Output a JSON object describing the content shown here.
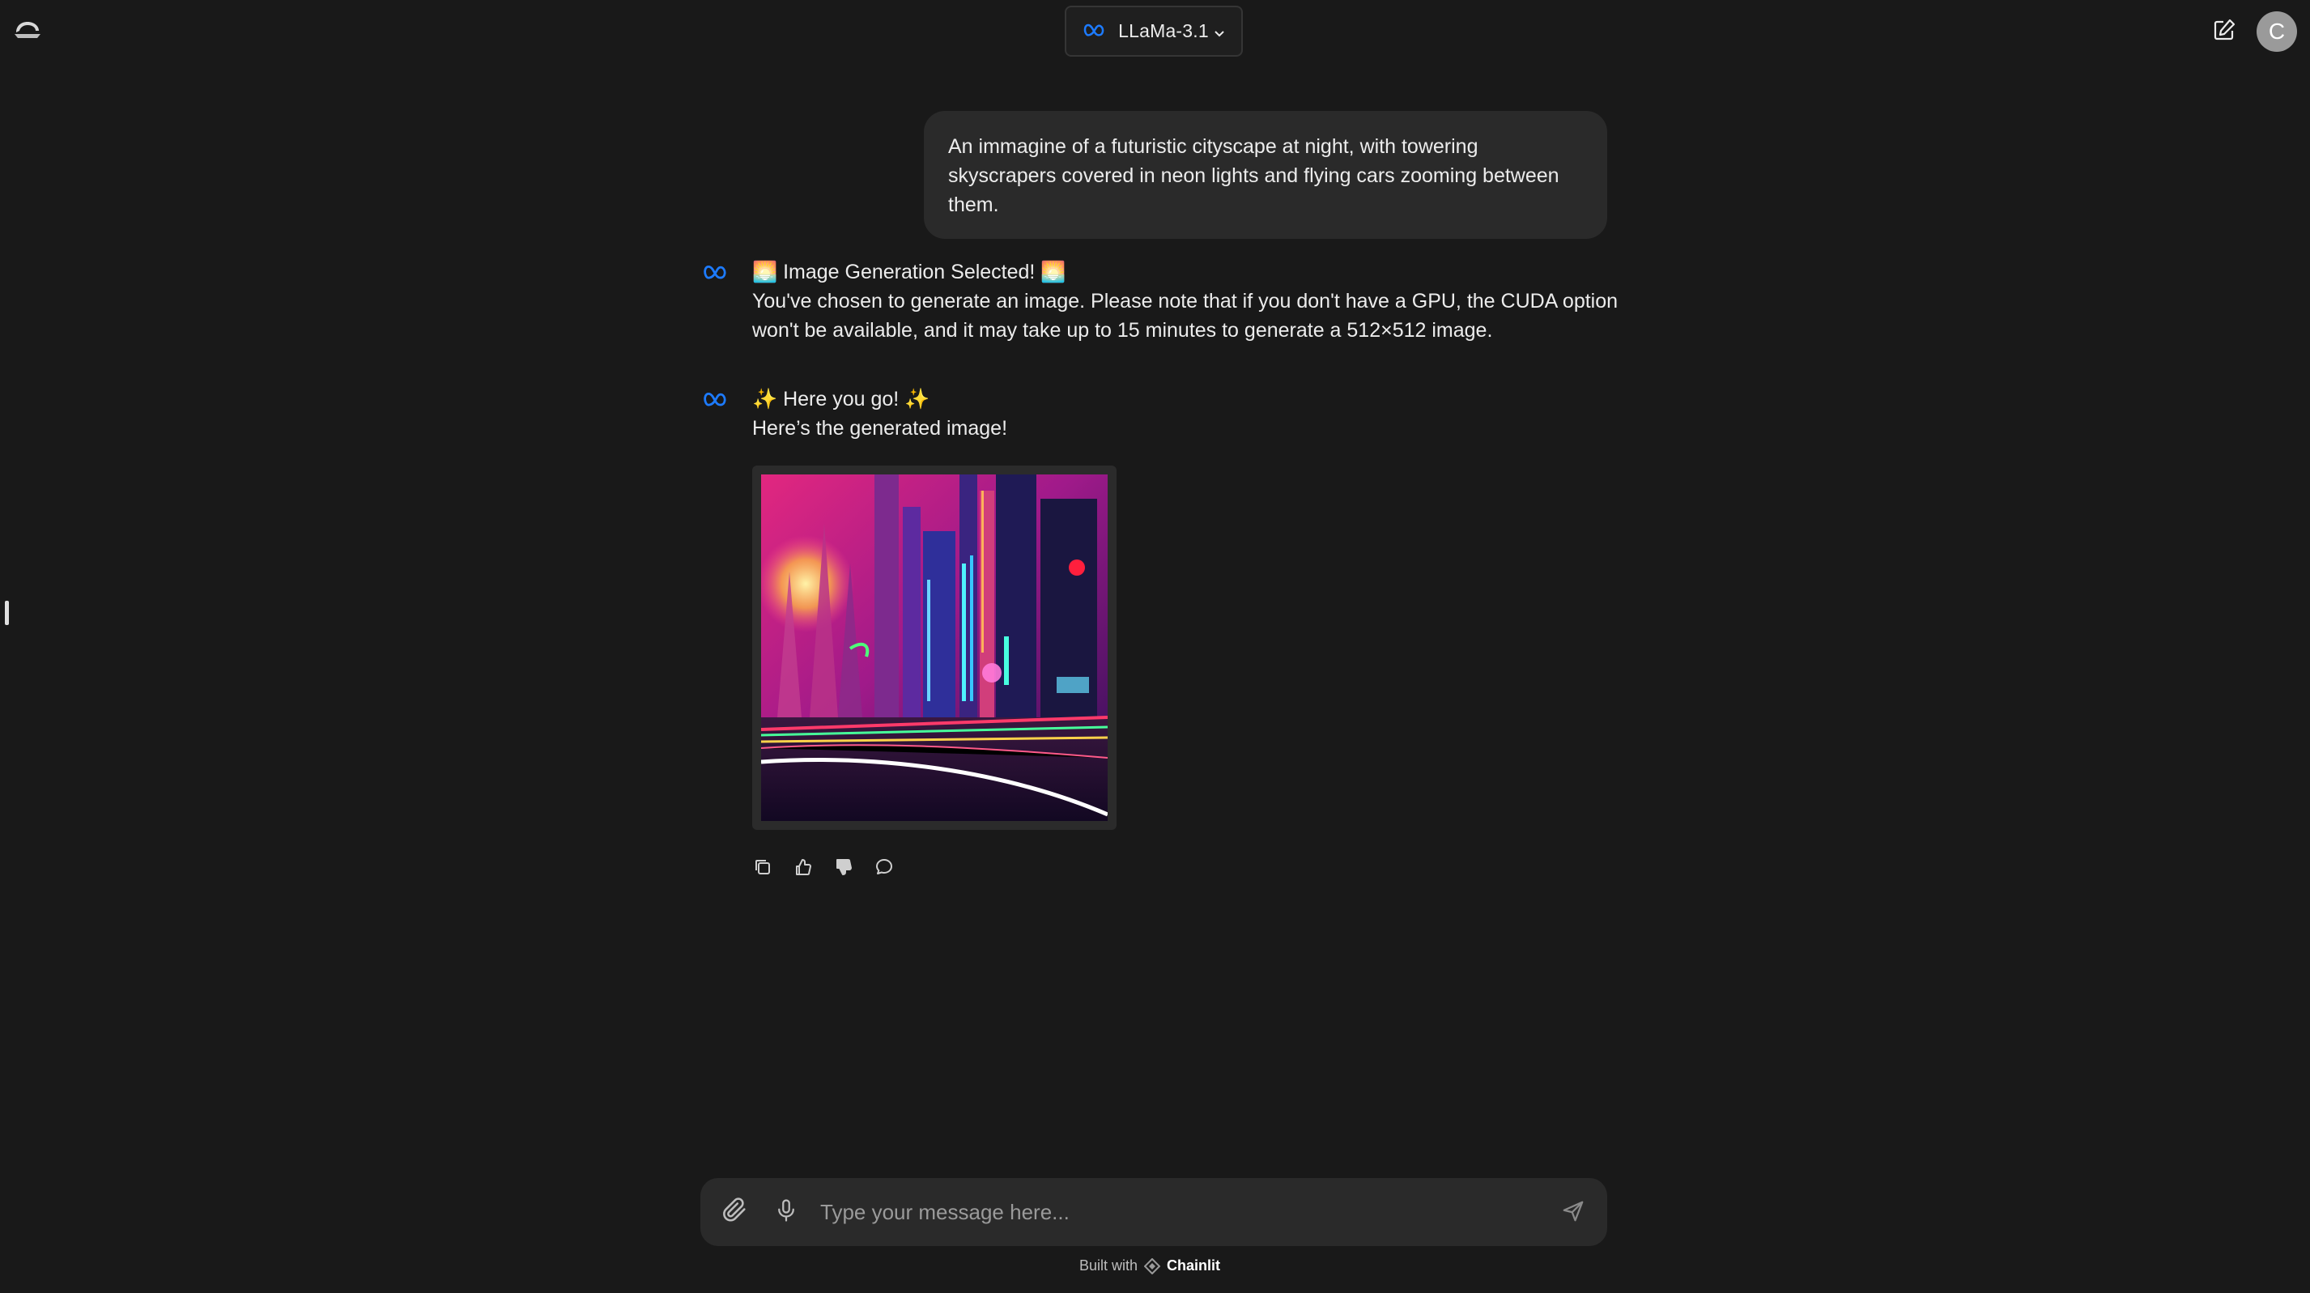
{
  "header": {
    "logo_icon": "chainlit-logo-icon",
    "model": {
      "label": "LLaMa-3.1",
      "icon": "meta-infinity-icon",
      "dropdown_icon": "chevron-down-icon"
    },
    "new_chat_icon": "edit-icon",
    "avatar_letter": "C"
  },
  "messages": {
    "user": {
      "text": "An immagine of a futuristic cityscape at night, with towering skyscrapers covered in neon lights and flying cars zooming between them."
    },
    "assistant_1": {
      "title": "🌅 Image Generation Selected! 🌅",
      "body": "You've chosen to generate an image. Please note that if you don't have a GPU, the CUDA option won't be available, and it may take up to 15 minutes to generate a 512×512 image."
    },
    "assistant_2": {
      "title": "✨ Here you go! ✨",
      "body": "Here’s the generated image!"
    }
  },
  "actions": {
    "icons": [
      "copy-icon",
      "thumbs-up-icon",
      "thumbs-down-icon",
      "comment-icon"
    ]
  },
  "composer": {
    "placeholder": "Type your message here...",
    "attach_icon": "paperclip-icon",
    "mic_icon": "microphone-icon",
    "send_icon": "send-icon"
  },
  "footer": {
    "built_with": "Built with",
    "brand": "Chainlit"
  },
  "colors": {
    "background": "#191919",
    "bubble": "#2a2a2a",
    "meta_blue": "#1d7bff",
    "text": "#ececec"
  }
}
